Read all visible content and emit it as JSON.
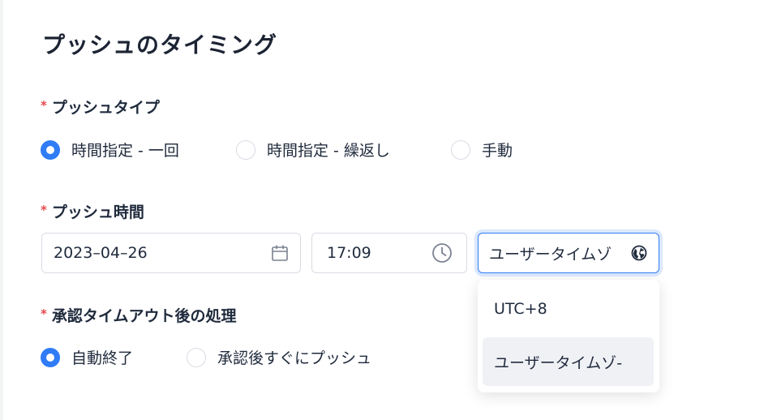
{
  "title": "プッシュのタイミング",
  "required_mark": "*",
  "push_type": {
    "label": "プッシュタイプ",
    "options": [
      "時間指定 - 一回",
      "時間指定 - 繰返し",
      "手動"
    ],
    "selected": "時間指定 - 一回"
  },
  "push_time": {
    "label": "プッシュ時間",
    "date": "2023–04–26",
    "time": "17:09",
    "timezone_value": "ユーザータイムゾ",
    "dropdown": {
      "options": [
        "UTC+8",
        "ユーザータイムゾ-"
      ],
      "selected": "ユーザータイムゾ-"
    }
  },
  "timeout": {
    "label": "承認タイムアウト後の処理",
    "options": [
      "自動終了",
      "承認後すぐにプッシュ"
    ],
    "selected": "自動終了"
  },
  "colors": {
    "accent": "#2f7cf6",
    "required": "#e5484d",
    "border": "#d9dce3",
    "selected_option_bg": "#f0f1f5"
  },
  "icons": {
    "date": "calendar-icon",
    "time": "clock-icon",
    "timezone": "globe-icon"
  }
}
